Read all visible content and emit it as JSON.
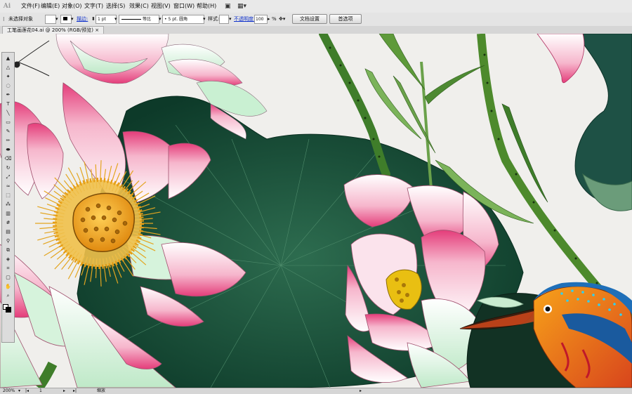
{
  "app": {
    "logo": "Ai"
  },
  "menu": [
    "文件(F)",
    "编辑(E)",
    "对象(O)",
    "文字(T)",
    "选择(S)",
    "效果(C)",
    "视图(V)",
    "窗口(W)",
    "帮助(H)"
  ],
  "control_bar": {
    "selection": "未选择对象",
    "stroke_label": "描边:",
    "stroke_weight": "1 pt",
    "profile": "等比",
    "brush": "5 pt. 圆角",
    "style_label": "样式:",
    "opacity_label": "不透明度:",
    "opacity_value": "100",
    "opacity_unit": "%",
    "doc_setup_button": "文档设置",
    "preferences_button": "首选项"
  },
  "document": {
    "tab_title": "工笔画莲花04.ai @ 200% (RGB/预览)"
  },
  "status": {
    "zoom": "200%",
    "page": "1",
    "mode": "缩放"
  },
  "tools": [
    "selection",
    "direct-selection",
    "magic-wand",
    "lasso",
    "pen",
    "type",
    "line",
    "rectangle",
    "paintbrush",
    "pencil",
    "blob-brush",
    "eraser",
    "rotate",
    "scale",
    "warp",
    "free-transform",
    "symbol-sprayer",
    "graph",
    "mesh",
    "gradient",
    "eyedropper",
    "blend",
    "live-paint",
    "slice",
    "artboard",
    "hand",
    "zoom"
  ],
  "colors": {
    "leaf_dark": "#0f3f2e",
    "leaf_mid": "#2a6a4f",
    "petal_pink": "#e8467e",
    "stem_green": "#4d8a2c",
    "pod_orange": "#f2a41a",
    "canvas_bg": "#f0efec"
  }
}
